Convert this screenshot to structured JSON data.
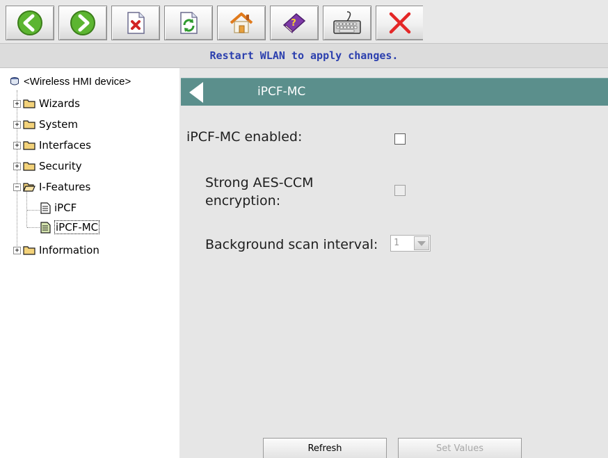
{
  "toolbar": {
    "buttons": [
      {
        "icon": "back-arrow-icon"
      },
      {
        "icon": "forward-arrow-icon"
      },
      {
        "icon": "delete-document-icon"
      },
      {
        "icon": "refresh-document-icon"
      },
      {
        "icon": "home-icon"
      },
      {
        "icon": "help-book-icon"
      },
      {
        "icon": "keyboard-icon"
      },
      {
        "icon": "close-icon"
      }
    ]
  },
  "status": {
    "message": "Restart WLAN to apply changes."
  },
  "tree": {
    "root_label": "<Wireless HMI device>",
    "items": [
      {
        "label": "Wizards",
        "expander": "+"
      },
      {
        "label": "System",
        "expander": "+"
      },
      {
        "label": "Interfaces",
        "expander": "+"
      },
      {
        "label": "Security",
        "expander": "+"
      },
      {
        "label": "I-Features",
        "expander": "−"
      },
      {
        "label": "Information",
        "expander": "+"
      }
    ],
    "children": [
      {
        "label": "iPCF"
      },
      {
        "label": "iPCF-MC"
      }
    ]
  },
  "panel": {
    "title": "iPCF-MC",
    "enabled_label": "iPCF-MC enabled:",
    "aes_label_line1": "Strong AES-CCM",
    "aes_label_line2": "encryption:",
    "scan_label": "Background scan interval:",
    "scan_value": "1"
  },
  "buttons": {
    "refresh": "Refresh",
    "set_values": "Set Values"
  },
  "colors": {
    "title_bar": "#5b8f8c",
    "status_text": "#2b3fae",
    "panel_bg": "#e6e6e6"
  }
}
